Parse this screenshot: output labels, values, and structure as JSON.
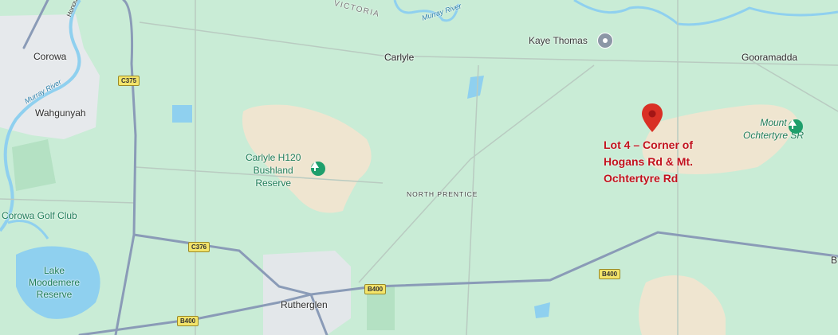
{
  "map": {
    "towns": {
      "corowa": "Corowa",
      "wahgunyah": "Wahgunyah",
      "carlyle": "Carlyle",
      "gooramadda": "Gooramadda",
      "rutherglen": "Rutherglen",
      "b_partial": "B"
    },
    "places": {
      "kaye_thomas": "Kaye Thomas",
      "corowa_golf": "Corowa Golf Club",
      "north_prentice": "NORTH PRENTICE",
      "victoria": "VICTORIA",
      "murray_river_1": "Murray River",
      "murray_river_2": "Murray River",
      "honour": "Honour"
    },
    "parks": {
      "carlyle_line1": "Carlyle H120",
      "carlyle_line2": "Bushland",
      "carlyle_line3": "Reserve",
      "ochtertyre_line1": "Mount",
      "ochtertyre_line2": "Ochtertyre SR",
      "lake_line1": "Lake",
      "lake_line2": "Moodemere",
      "lake_line3": "Reserve"
    },
    "roads": {
      "c375": "C375",
      "c376": "C376",
      "b400_a": "B400",
      "b400_b": "B400",
      "b400_c": "B400"
    },
    "marker": {
      "line1": "Lot 4 – Corner of",
      "line2": "Hogans Rd & Mt.",
      "line3": "Ochtertyre Rd",
      "color": "#d93025"
    },
    "colors": {
      "land": "#c9ecd6",
      "reserve": "#efe5d0",
      "water": "#8fd0ef",
      "road": "#8a9bb7",
      "callout": "#c2121d"
    }
  }
}
